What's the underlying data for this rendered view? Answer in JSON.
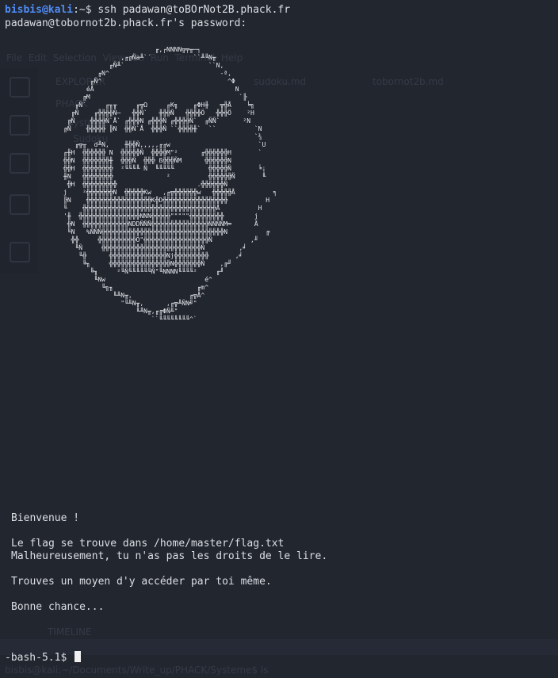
{
  "prompt1": {
    "user": "bisbis",
    "at": "@",
    "host": "kali",
    "path": ":~",
    "sigil": "$ ",
    "command": "ssh padawan@toBOrNot2B.phack.fr"
  },
  "password_prompt": "padawan@tobornot2b.phack.fr's password:",
  "welcome": "Bienvenue !",
  "flag_line": "Le flag se trouve dans /home/master/flag.txt",
  "rights_line": "Malheureusement, tu n'as pas les droits de le lire.",
  "hint_line": "Trouves un moyen d'y accéder par toi même.",
  "luck_line": "Bonne chance...",
  "final_prompt": "-bash-5.1$ ",
  "background_ghost": {
    "menu": "File  Edit  Selection  View  Go  Run  Terminal  Help",
    "explorer": "EXPLORER",
    "phack": "PHACK",
    "systeme": "Systeme",
    "sudoku": "Sudoku",
    "tab1": "sudoku.md",
    "tab2": "tobornot2b.md",
    "timeline": "TIMELINE",
    "bottom_prompt": "bisbis@kali:~/Documents/Write_up/PHACK/Systeme$ ls"
  }
}
